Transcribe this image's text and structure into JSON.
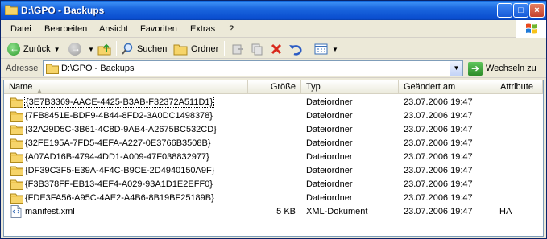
{
  "window": {
    "title": "D:\\GPO - Backups"
  },
  "menu": [
    {
      "label": "Datei"
    },
    {
      "label": "Bearbeiten"
    },
    {
      "label": "Ansicht"
    },
    {
      "label": "Favoriten"
    },
    {
      "label": "Extras"
    },
    {
      "label": "?"
    }
  ],
  "toolbar": {
    "back_label": "Zurück",
    "search_label": "Suchen",
    "folders_label": "Ordner"
  },
  "address": {
    "label": "Adresse",
    "value": "D:\\GPO - Backups",
    "go_label": "Wechseln zu"
  },
  "columns": {
    "name": "Name",
    "size": "Größe",
    "type": "Typ",
    "modified": "Geändert am",
    "attrs": "Attribute"
  },
  "rows": [
    {
      "name": "{3E7B3369-AACE-4425-B3AB-F32372A511D1}",
      "size": "",
      "type": "Dateiordner",
      "modified": "23.07.2006 19:47",
      "attrs": "",
      "kind": "folder"
    },
    {
      "name": "{7FB8451E-BDF9-4B44-8FD2-3A0DC1498378}",
      "size": "",
      "type": "Dateiordner",
      "modified": "23.07.2006 19:47",
      "attrs": "",
      "kind": "folder"
    },
    {
      "name": "{32A29D5C-3B61-4C8D-9AB4-A2675BC532CD}",
      "size": "",
      "type": "Dateiordner",
      "modified": "23.07.2006 19:47",
      "attrs": "",
      "kind": "folder"
    },
    {
      "name": "{32FE195A-7FD5-4EFA-A227-0E3766B3508B}",
      "size": "",
      "type": "Dateiordner",
      "modified": "23.07.2006 19:47",
      "attrs": "",
      "kind": "folder"
    },
    {
      "name": "{A07AD16B-4794-4DD1-A009-47F038832977}",
      "size": "",
      "type": "Dateiordner",
      "modified": "23.07.2006 19:47",
      "attrs": "",
      "kind": "folder"
    },
    {
      "name": "{DF39C3F5-E39A-4F4C-B9CE-2D4940150A9F}",
      "size": "",
      "type": "Dateiordner",
      "modified": "23.07.2006 19:47",
      "attrs": "",
      "kind": "folder"
    },
    {
      "name": "{F3B378FF-EB13-4EF4-A029-93A1D1E2EFF0}",
      "size": "",
      "type": "Dateiordner",
      "modified": "23.07.2006 19:47",
      "attrs": "",
      "kind": "folder"
    },
    {
      "name": "{FDE3FA56-A95C-4AE2-A4B6-8B19BF25189B}",
      "size": "",
      "type": "Dateiordner",
      "modified": "23.07.2006 19:47",
      "attrs": "",
      "kind": "folder"
    },
    {
      "name": "manifest.xml",
      "size": "5 KB",
      "type": "XML-Dokument",
      "modified": "23.07.2006 19:47",
      "attrs": "HA",
      "kind": "xml"
    }
  ]
}
